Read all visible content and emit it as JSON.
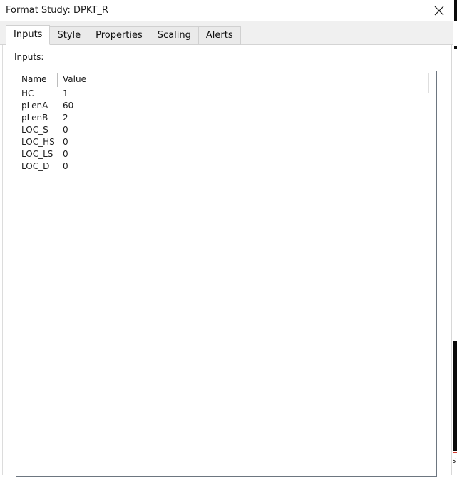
{
  "window": {
    "title": "Format Study: DPKT_R",
    "close_label": "✕",
    "close_icon": "close-icon"
  },
  "tabs": [
    {
      "label": "Inputs",
      "active": true
    },
    {
      "label": "Style",
      "active": false
    },
    {
      "label": "Properties",
      "active": false
    },
    {
      "label": "Scaling",
      "active": false
    },
    {
      "label": "Alerts",
      "active": false
    }
  ],
  "inputs_panel": {
    "section_label": "Inputs:",
    "columns": [
      "Name",
      "Value"
    ],
    "rows": [
      {
        "name": "HC",
        "value": "1"
      },
      {
        "name": "pLenA",
        "value": "60"
      },
      {
        "name": "pLenB",
        "value": "2"
      },
      {
        "name": "LOC_S",
        "value": "0"
      },
      {
        "name": "LOC_HS",
        "value": "0"
      },
      {
        "name": "LOC_LS",
        "value": "0"
      },
      {
        "name": "LOC_D",
        "value": "0"
      }
    ]
  },
  "background_sliver": {
    "glyph": "S"
  },
  "colors": {
    "window_bg": "#ffffff",
    "tabstrip_bg": "#f0f0f0",
    "tab_inactive_bg": "#eaeaea",
    "tab_border": "#d0d0d0",
    "grid_border": "#6d7680",
    "text": "#1c1c1c",
    "accent_red": "#d23b2e"
  }
}
